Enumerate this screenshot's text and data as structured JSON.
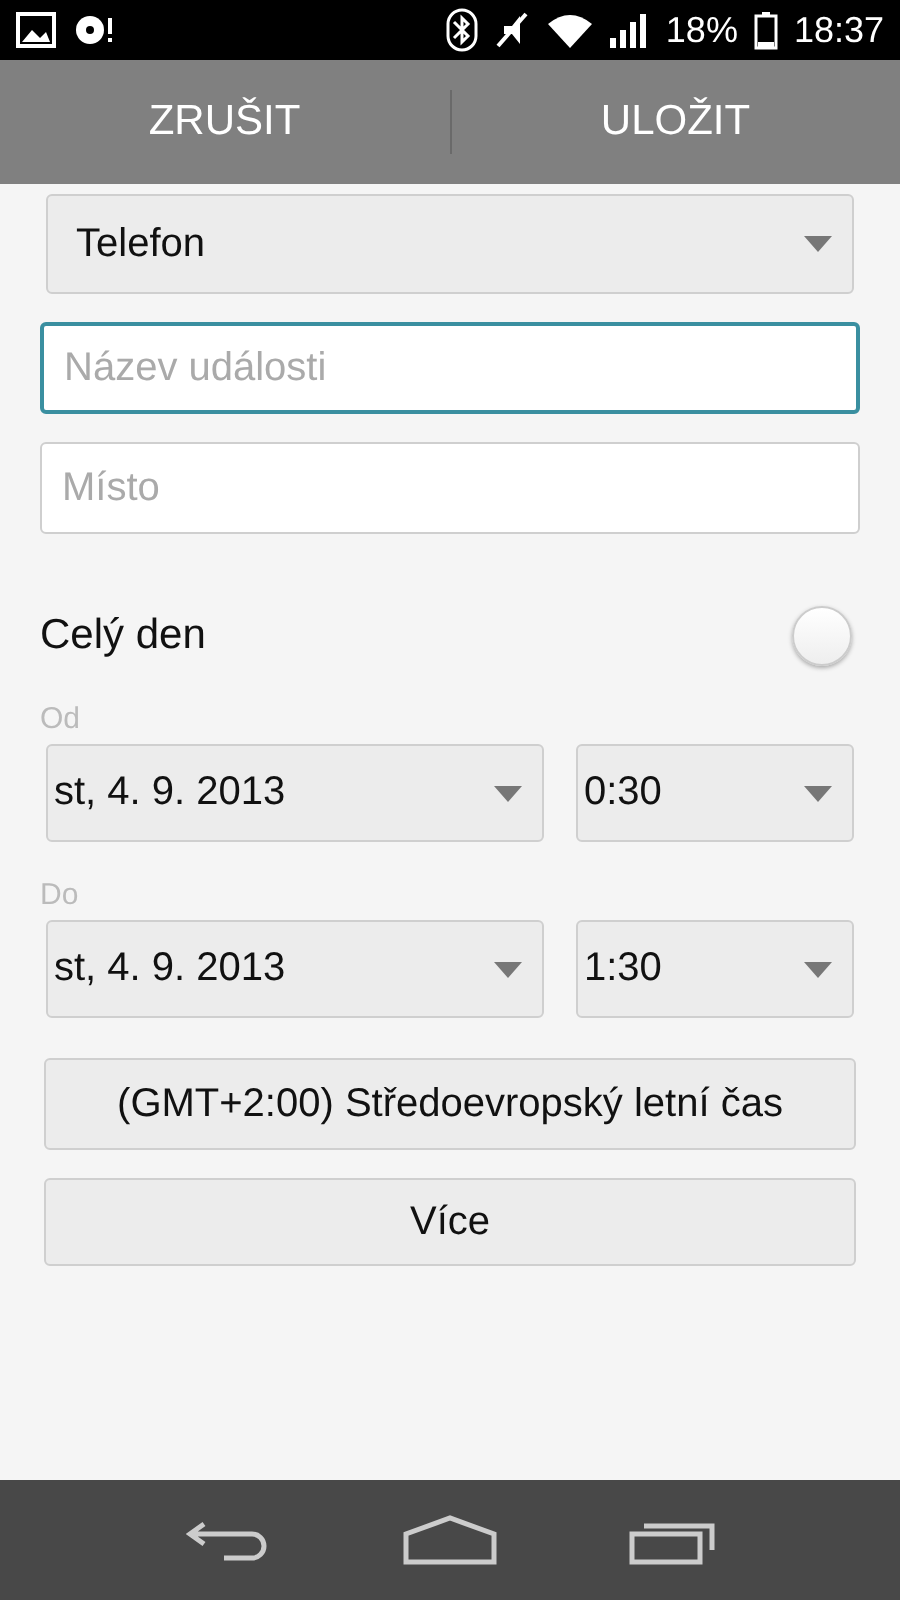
{
  "status_bar": {
    "battery": "18%",
    "time": "18:37"
  },
  "action_bar": {
    "buttons": [
      "ZRUŠIT",
      "ULOŽIT"
    ]
  },
  "calendar": {
    "value": "Telefon"
  },
  "title_field": {
    "placeholder": "Název události",
    "focused": true
  },
  "location_field": {
    "placeholder": "Místo",
    "focused": false
  },
  "all_day": {
    "label": "Celý den",
    "checked": false
  },
  "from": {
    "label": "Od",
    "date": "st, 4. 9. 2013",
    "time": "0:30"
  },
  "to": {
    "label": "Do",
    "date": "st, 4. 9. 2013",
    "time": "1:30"
  },
  "timezone_button": "(GMT+2:00) Středoevropský letní čas",
  "more_button": "Více"
}
